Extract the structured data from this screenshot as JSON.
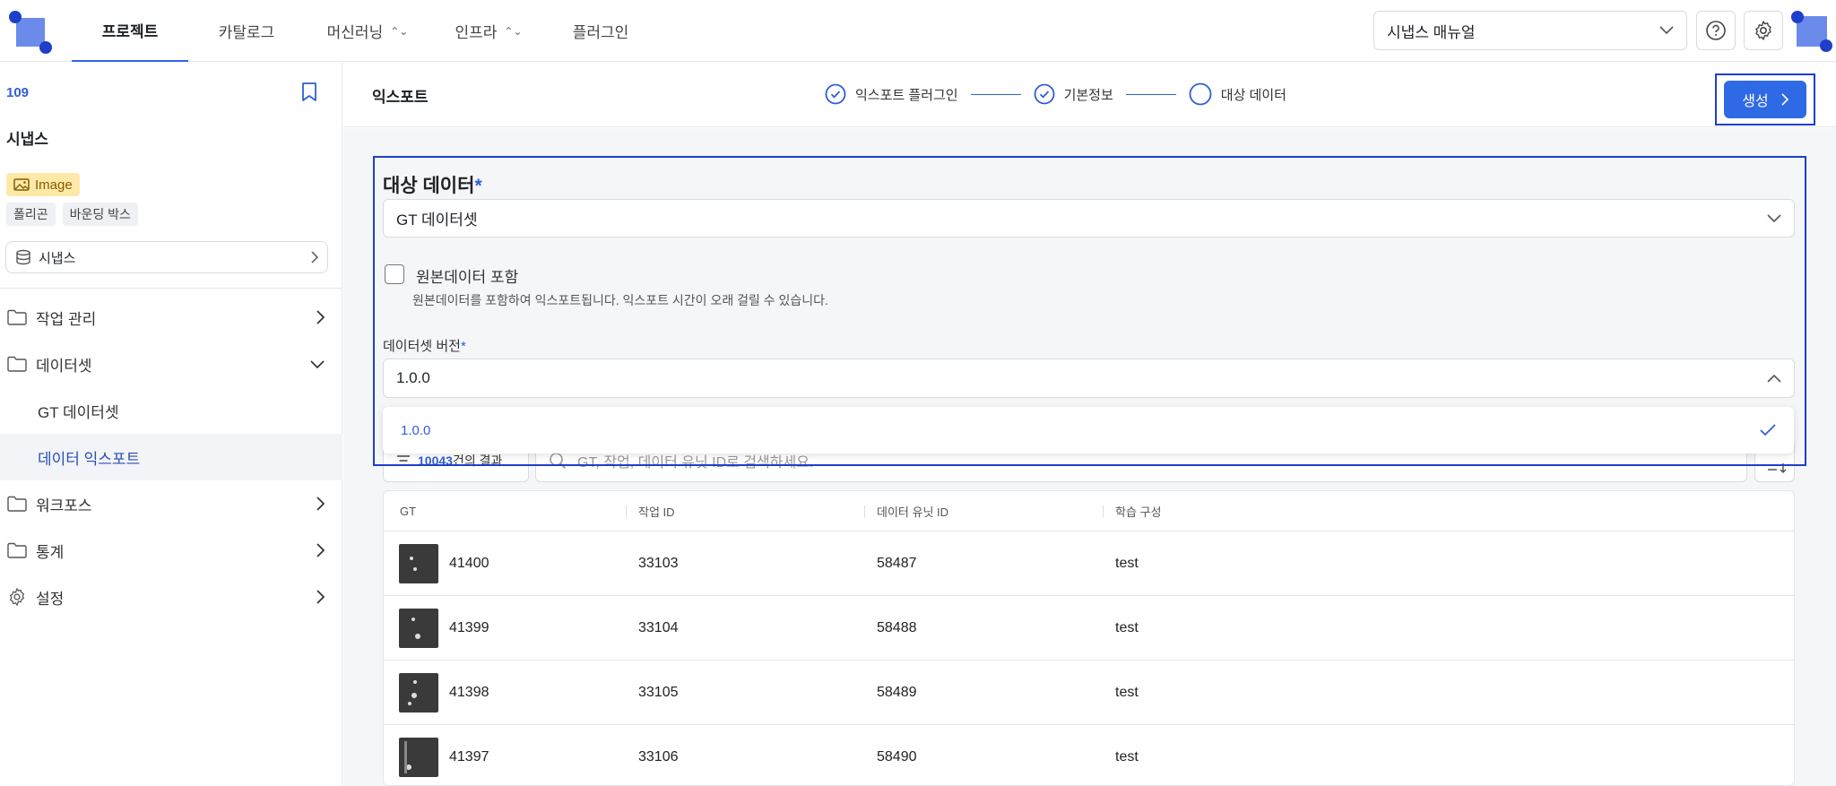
{
  "header": {
    "nav": [
      {
        "label": "프로젝트",
        "active": true,
        "has_dropdown": false
      },
      {
        "label": "카탈로그",
        "active": false,
        "has_dropdown": false
      },
      {
        "label": "머신러닝",
        "active": false,
        "has_dropdown": true
      },
      {
        "label": "인프라",
        "active": false,
        "has_dropdown": true
      },
      {
        "label": "플러그인",
        "active": false,
        "has_dropdown": false
      }
    ],
    "manual_select": "시냅스 매뉴얼",
    "accent": "#2f66e6"
  },
  "sidebar": {
    "project_id": "109",
    "project_name": "시냅스",
    "type_tag": "Image",
    "tags": [
      "폴리곤",
      "바운딩 박스"
    ],
    "dataset_selector": "시냅스",
    "menu": {
      "work": "작업 관리",
      "dataset": "데이터셋",
      "dataset_children": [
        "GT 데이터셋",
        "데이터 익스포트"
      ],
      "workforce": "워크포스",
      "stats": "통계",
      "settings": "설정"
    }
  },
  "main": {
    "title": "익스포트",
    "steps": [
      {
        "label": "익스포트 플러그인",
        "done": true
      },
      {
        "label": "기본정보",
        "done": true
      },
      {
        "label": "대상 데이터",
        "done": false
      }
    ],
    "create_button": "생성",
    "form": {
      "section_title": "대상 데이터",
      "required_mark": "*",
      "target_select": "GT 데이터셋",
      "include_original_label": "원본데이터 포함",
      "include_original_help": "원본데이터를 포함하여 익스포트됩니다. 익스포트 시간이 오래 걸릴 수 있습니다.",
      "version_label": "데이터셋 버전",
      "version_value": "1.0.0",
      "version_options": [
        "1.0.0"
      ]
    },
    "results": {
      "count": "10043",
      "suffix": "건의 결과",
      "search_placeholder": "GT, 작업, 데이터 유닛 ID로 검색하세요."
    },
    "table": {
      "columns": [
        "GT",
        "작업 ID",
        "데이터 유닛 ID",
        "학습 구성"
      ],
      "rows": [
        {
          "gt": "41400",
          "task_id": "33103",
          "unit_id": "58487",
          "split": "test"
        },
        {
          "gt": "41399",
          "task_id": "33104",
          "unit_id": "58488",
          "split": "test"
        },
        {
          "gt": "41398",
          "task_id": "33105",
          "unit_id": "58489",
          "split": "test"
        },
        {
          "gt": "41397",
          "task_id": "33106",
          "unit_id": "58490",
          "split": "test"
        }
      ]
    }
  }
}
